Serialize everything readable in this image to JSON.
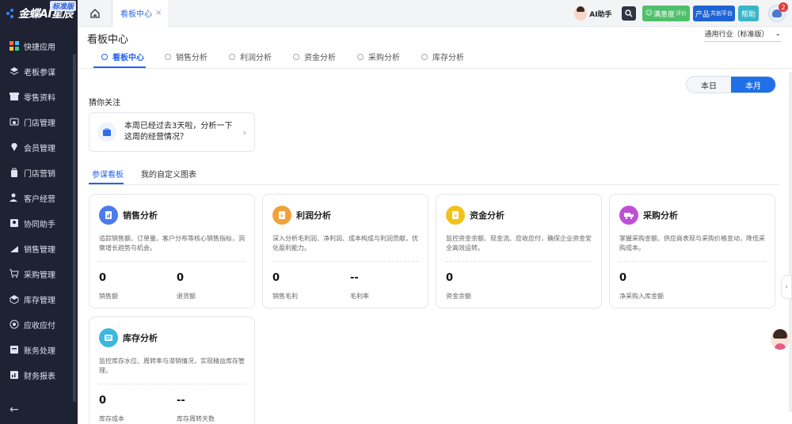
{
  "brand": {
    "name": "金蝶AI星辰",
    "edition": "标准版"
  },
  "sidebar": {
    "items": [
      {
        "label": "快捷应用",
        "icon": "grid-icon"
      },
      {
        "label": "老板参谋",
        "icon": "layers-icon"
      },
      {
        "label": "零售资料",
        "icon": "shop-icon"
      },
      {
        "label": "门店管理",
        "icon": "store-icon"
      },
      {
        "label": "会员管理",
        "icon": "diamond-icon"
      },
      {
        "label": "门店营销",
        "icon": "bag-icon"
      },
      {
        "label": "客户经营",
        "icon": "customer-icon"
      },
      {
        "label": "协同助手",
        "icon": "assistant-icon"
      },
      {
        "label": "销售管理",
        "icon": "sales-icon"
      },
      {
        "label": "采购管理",
        "icon": "cart-icon"
      },
      {
        "label": "库存管理",
        "icon": "box-icon"
      },
      {
        "label": "应收应付",
        "icon": "money-icon"
      },
      {
        "label": "账务处理",
        "icon": "ledger-icon"
      },
      {
        "label": "财务报表",
        "icon": "report-icon"
      }
    ]
  },
  "topbar": {
    "tab_label": "看板中心",
    "ai_label": "AI助手",
    "satisfaction_label": "满意度",
    "satisfaction_sub": "评价",
    "product_label": "产品",
    "product_sub": "共创平台",
    "help_label": "帮助",
    "notification_count": "2"
  },
  "main": {
    "title": "看板中心",
    "industry": "通用行业（标准版）",
    "tabs": [
      "看板中心",
      "销售分析",
      "利润分析",
      "资金分析",
      "采购分析",
      "库存分析"
    ],
    "period": {
      "day": "本日",
      "month": "本月"
    },
    "guess_title": "猜你关注",
    "guess_text": "本周已经过去3天啦，分析一下这周的经营情况？",
    "panel_tabs": [
      "参谋看板",
      "我的自定义图表"
    ]
  },
  "cards": [
    {
      "title": "销售分析",
      "desc": "追踪销售额、订单量、客户分布等核心销售指标，洞察增长趋势与机会。",
      "color": "#4a7cf0",
      "metrics": [
        {
          "value": "0",
          "label": "销售额"
        },
        {
          "value": "0",
          "label": "退货额"
        }
      ]
    },
    {
      "title": "利润分析",
      "desc": "深入分析毛利润、净利润、成本构成与利润贡献，优化盈利能力。",
      "color": "#f0a23a",
      "metrics": [
        {
          "value": "0",
          "label": "销售毛利"
        },
        {
          "value": "--",
          "label": "毛利率"
        }
      ]
    },
    {
      "title": "资金分析",
      "desc": "监控资金余额、现金流、应收应付，确保企业资金安全高效运转。",
      "color": "#f2c21b",
      "metrics": [
        {
          "value": "0",
          "label": "资金余额"
        }
      ]
    },
    {
      "title": "采购分析",
      "desc": "掌握采购金额、供应商表现与采购价格变动，降低采购成本。",
      "color": "#c04fd8",
      "metrics": [
        {
          "value": "0",
          "label": "净采购入库金额"
        }
      ]
    },
    {
      "title": "库存分析",
      "desc": "监控库存水位、周转率与滞销情况，实现精益库存管理。",
      "color": "#3cb7e0",
      "metrics": [
        {
          "value": "0",
          "label": "库存成本"
        },
        {
          "value": "--",
          "label": "库存周转天数"
        }
      ]
    }
  ]
}
